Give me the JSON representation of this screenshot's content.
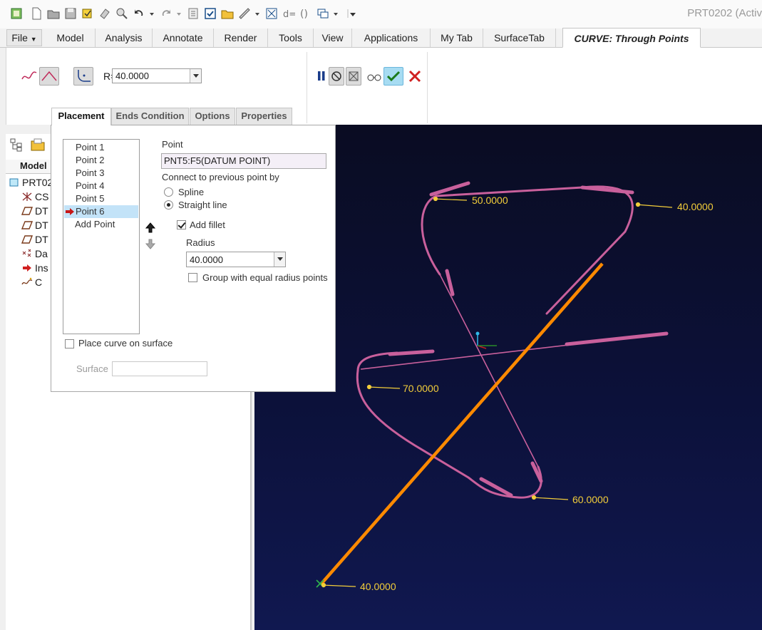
{
  "window": {
    "title": "PRT0202 (Activ"
  },
  "quick_access": {
    "icons": [
      "view-icon",
      "new-icon",
      "open-icon",
      "save-icon",
      "regenerate-icon",
      "erase-icon",
      "find-icon",
      "undo-icon",
      "redo-icon",
      "regenerate-manager-icon",
      "select-icon",
      "folder-icon",
      "measure-icon",
      "relations-icon",
      "dimension-icon",
      "parameters-icon",
      "windows-icon",
      "customize-icon"
    ]
  },
  "tabs": [
    {
      "label": "File",
      "kind": "file"
    },
    {
      "label": "Model"
    },
    {
      "label": "Analysis"
    },
    {
      "label": "Annotate"
    },
    {
      "label": "Render"
    },
    {
      "label": "Tools"
    },
    {
      "label": "View"
    },
    {
      "label": "Applications"
    },
    {
      "label": "My Tab"
    },
    {
      "label": "SurfaceTab"
    },
    {
      "label": "CURVE: Through Points",
      "kind": "active"
    }
  ],
  "ribbon": {
    "radius_label": "R=",
    "radius_value": "40.0000",
    "controls": [
      "spline-mode-icon",
      "straight-line-mode-icon",
      "fillet-radius-icon",
      "pause-icon",
      "no-preview-icon",
      "preview-icon",
      "glasses-preview-icon",
      "confirm-icon",
      "cancel-icon"
    ]
  },
  "slide_tabs": [
    {
      "label": "Placement",
      "active": true
    },
    {
      "label": "Ends Condition"
    },
    {
      "label": "Options"
    },
    {
      "label": "Properties"
    }
  ],
  "tree": {
    "header": "Model",
    "items": [
      {
        "label": "PRT02",
        "icon": "part-icon"
      },
      {
        "label": "CS",
        "icon": "csys-icon"
      },
      {
        "label": "DT",
        "icon": "datum-plane-icon"
      },
      {
        "label": "DT",
        "icon": "datum-plane-icon"
      },
      {
        "label": "DT",
        "icon": "datum-plane-icon"
      },
      {
        "label": "Da",
        "icon": "datum-point-icon"
      },
      {
        "label": "Ins",
        "icon": "insert-here-icon"
      },
      {
        "label": "C",
        "icon": "curve-icon"
      }
    ]
  },
  "placement": {
    "points": [
      "Point 1",
      "Point 2",
      "Point 3",
      "Point 4",
      "Point 5",
      "Point 6"
    ],
    "selected_point": "Point 6",
    "add_point": "Add Point",
    "point_label": "Point",
    "point_value": "PNT5:F5(DATUM POINT)",
    "connect_label": "Connect to previous point by",
    "options": [
      {
        "label": "Spline",
        "selected": false
      },
      {
        "label": "Straight line",
        "selected": true
      }
    ],
    "add_fillet": {
      "label": "Add fillet",
      "checked": true
    },
    "radius_label": "Radius",
    "radius_value": "40.0000",
    "group_equal": {
      "label": "Group with equal radius points",
      "checked": false
    },
    "place_on_surface": {
      "label": "Place curve on surface",
      "checked": false
    },
    "surface_label": "Surface",
    "surface_value": ""
  },
  "graphics": {
    "colors": {
      "curve": "#c9609c",
      "selected_segment": "#ff8a00",
      "dimension": "#f2cd3a",
      "background": "#0c113a"
    },
    "dimensions": [
      "50.0000",
      "40.0000",
      "70.0000",
      "60.0000",
      "40.0000"
    ]
  }
}
